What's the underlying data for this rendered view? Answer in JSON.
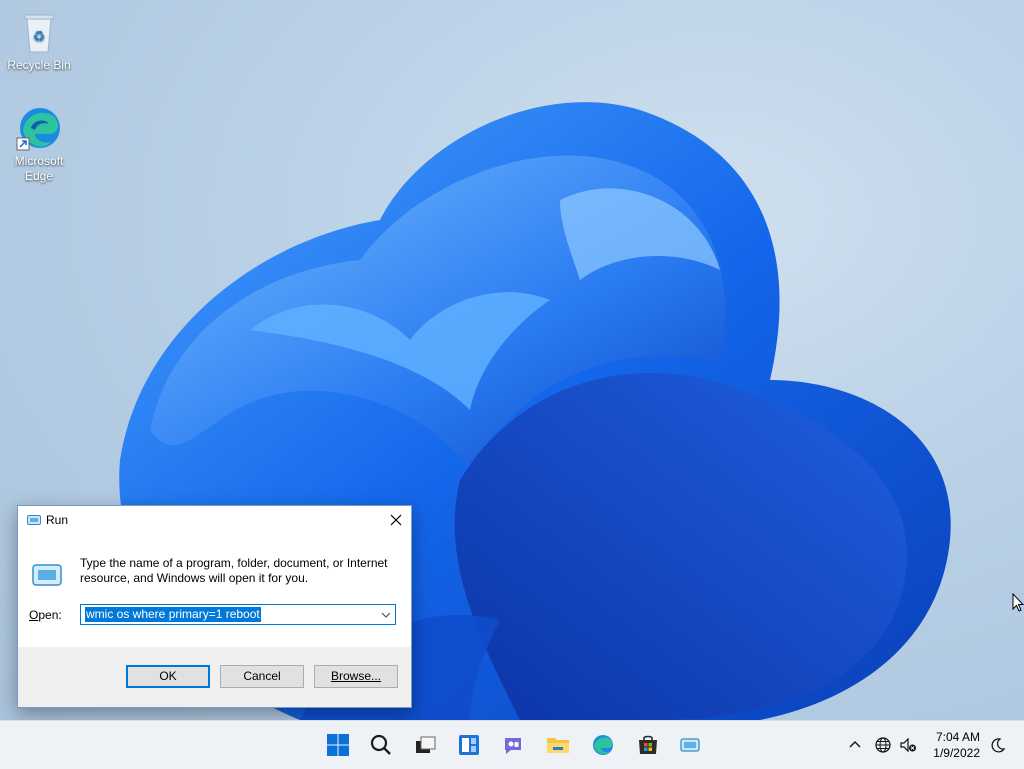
{
  "desktop": {
    "icons": [
      {
        "label": "Recycle Bin",
        "icon": "recycle-bin-icon"
      },
      {
        "label": "Microsoft\nEdge",
        "label_line1": "Microsoft",
        "label_line2": "Edge",
        "icon": "edge-icon"
      }
    ]
  },
  "run_dialog": {
    "title": "Run",
    "description": "Type the name of a program, folder, document, or Internet resource, and Windows will open it for you.",
    "open_label_prefix": "",
    "open_label_underlined": "O",
    "open_label_rest": "pen:",
    "command_value": "wmic os where primary=1 reboot",
    "buttons": {
      "ok": "OK",
      "cancel": "Cancel",
      "browse": "Browse..."
    }
  },
  "taskbar": {
    "pinned": [
      "start-icon",
      "search-icon",
      "task-view-icon",
      "widgets-icon",
      "chat-icon",
      "file-explorer-icon",
      "edge-icon",
      "store-icon",
      "run-icon"
    ],
    "tray": {
      "clock_time": "7:04 AM",
      "clock_date": "1/9/2022"
    }
  },
  "colors": {
    "accent": "#0078d7",
    "wallpaper_blue": "#1a6ef5",
    "taskbar_bg": "#eef1f6"
  }
}
